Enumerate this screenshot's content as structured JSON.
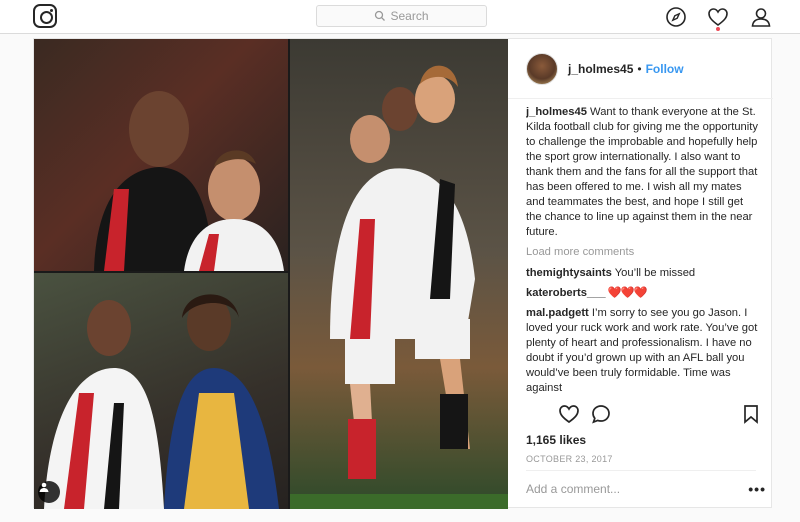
{
  "topbar": {
    "logo": "instagram-logo",
    "search_placeholder": "Search",
    "icons": [
      "compass-icon",
      "heart-icon",
      "user-icon"
    ]
  },
  "post": {
    "username": "j_holmes45",
    "separator": "•",
    "follow_label": "Follow",
    "caption_user": "j_holmes45",
    "caption_text": " Want to thank everyone at the St. Kilda football club for giving me the opportunity to challenge the improbable and hopefully help the sport grow internationally. I also want to thank them and the fans for all the support that has been offered to me. I wish all my mates and teammates the best, and hope I still get the chance to line up against them in the near future.",
    "load_more": "Load more comments",
    "comments": [
      {
        "user": "themightysaints",
        "text": " You’ll be missed"
      },
      {
        "user": "kateroberts___",
        "text": " ❤️❤️❤️"
      },
      {
        "user": "mal.padgett",
        "text": " I’m sorry to see you go Jason. I loved your ruck work and work rate. You’ve got plenty of heart and professionalism. I have no doubt if you’d grown up with an AFL ball you would’ve been truly formidable. Time was against"
      }
    ],
    "likes": "1,165 likes",
    "date": "OCTOBER 23, 2017",
    "add_comment_placeholder": "Add a comment...",
    "more_label": "•••"
  },
  "colors": {
    "link": "#3897f0",
    "notification": "#ed4956",
    "border": "#dbdbdb"
  }
}
